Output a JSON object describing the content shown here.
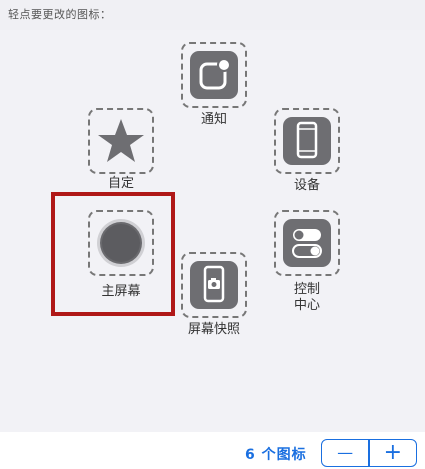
{
  "header": {
    "instruction": "轻点要更改的图标："
  },
  "icons": {
    "notification": {
      "label": "通知",
      "icon": "notification-badge-icon"
    },
    "custom": {
      "label": "自定",
      "icon": "star-icon"
    },
    "device": {
      "label": "设备",
      "icon": "phone-device-icon"
    },
    "home": {
      "label": "主屏幕",
      "icon": "home-button-icon"
    },
    "control_center": {
      "label": "控制\n中心",
      "icon": "toggle-switch-icon"
    },
    "screenshot": {
      "label": "屏幕快照",
      "icon": "camera-phone-icon"
    }
  },
  "footer": {
    "count_label": "6 个图标",
    "minus": "—",
    "plus": "+"
  },
  "colors": {
    "accent": "#1a6fe0",
    "selection": "#b01818",
    "icon_fill": "#6e6e72"
  }
}
